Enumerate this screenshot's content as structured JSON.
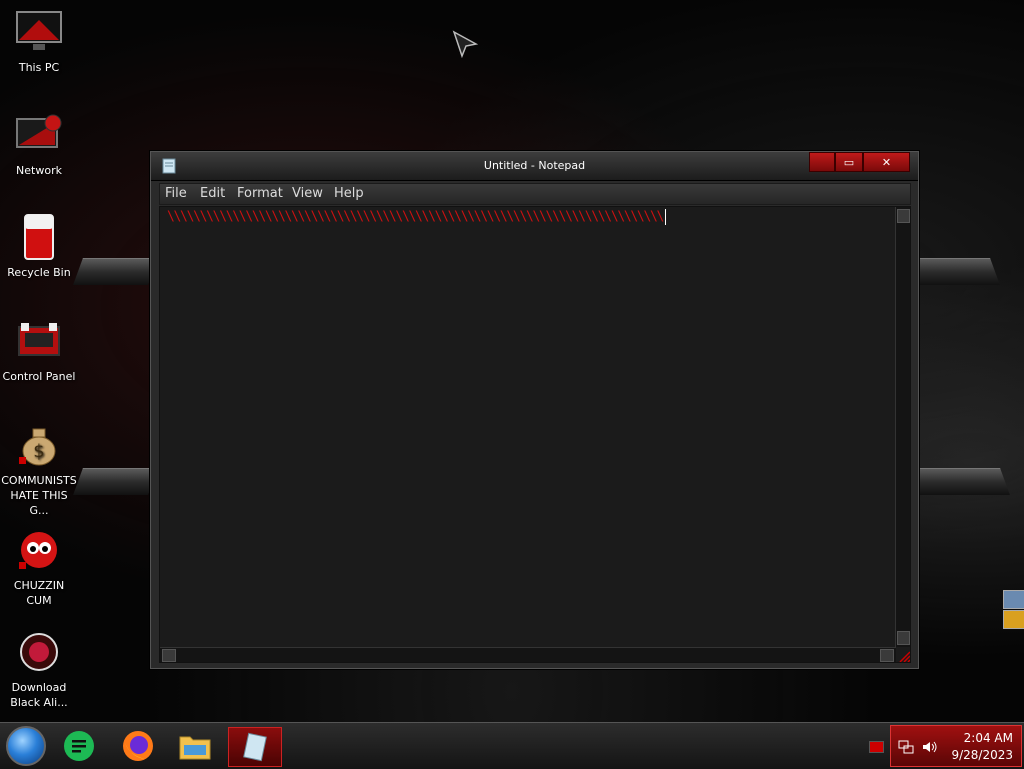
{
  "desktop": {
    "icons": [
      {
        "label": "This PC"
      },
      {
        "label": "Network"
      },
      {
        "label": "Recycle Bin"
      },
      {
        "label": "Control Panel"
      },
      {
        "label": "COMMUNISTS HATE THIS G..."
      },
      {
        "label": "CHUZZIN CUM"
      },
      {
        "label": "Download Black Ali..."
      }
    ]
  },
  "notepad": {
    "title": "Untitled - Notepad",
    "minimize_label": "▭",
    "close_label": "✕",
    "menu": [
      "File",
      "Edit",
      "Format",
      "View",
      "Help"
    ],
    "content": "\\\\\\\\\\\\\\\\\\\\\\\\\\\\\\\\\\\\\\\\\\\\\\\\\\\\\\\\\\\\\\\\\\\\\\\\\\\\\\\\\\\\\\\\\\\\\\\\\\\\\\\\\\\\\\\\\\\\\\\\\\\\\\\\\\\\\\\\\\\\\\\\\\\\\\\\"
  },
  "taskbar": {
    "items": [
      "start-orb",
      "sticky-notes-icon",
      "firefox-icon",
      "file-explorer-icon",
      "notepad-icon"
    ],
    "active": "notepad-icon",
    "clock": {
      "time": "2:04 AM",
      "date": "9/28/2023"
    }
  },
  "colors": {
    "accent": "#b00f0f",
    "text_red": "#cc1111",
    "window_bg": "#1b1b1b"
  }
}
